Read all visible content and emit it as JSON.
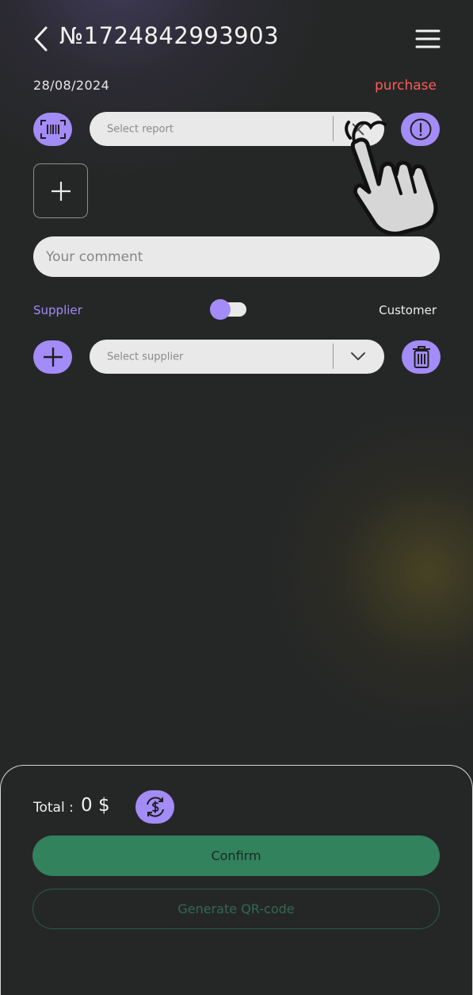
{
  "header": {
    "title": "№1724842993903",
    "back_icon": "chevron-left-icon",
    "menu_icon": "hamburger-menu-icon"
  },
  "meta": {
    "date": "28/08/2024",
    "type": "purchase"
  },
  "report": {
    "placeholder": "Select report",
    "scan_icon": "barcode-scan-icon",
    "clear_icon": "close-icon",
    "info_icon": "exclamation-circle-icon"
  },
  "add_item": {
    "icon": "plus-icon"
  },
  "comment": {
    "placeholder": "Your comment"
  },
  "party_toggle": {
    "left_label": "Supplier",
    "right_label": "Customer",
    "selected": "Supplier"
  },
  "supplier": {
    "placeholder": "Select supplier",
    "add_icon": "plus-icon",
    "dropdown_icon": "chevron-down-icon",
    "delete_icon": "trash-icon"
  },
  "footer": {
    "total_label": "Total :",
    "total_value": "0 $",
    "currency_icon": "currency-exchange-icon",
    "confirm_label": "Confirm",
    "qr_label": "Generate QR-code"
  },
  "overlay": {
    "icon": "hand-pointer-icon"
  },
  "colors": {
    "accent": "#a38cf7",
    "purchase": "#ff5a55",
    "confirm": "#32825d",
    "background": "#252727"
  }
}
